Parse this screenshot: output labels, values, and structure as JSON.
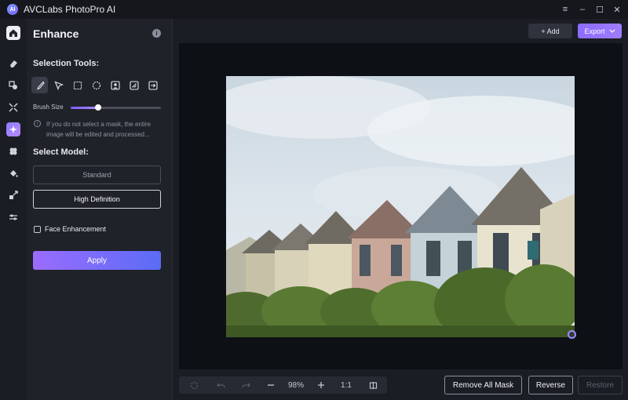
{
  "app": {
    "title": "AVCLabs PhotoPro AI",
    "logo_text": "AI"
  },
  "window_controls": {
    "settings": "≡",
    "minimize": "–",
    "maximize": "☐",
    "close": "✕"
  },
  "panel": {
    "title": "Enhance",
    "selection_tools_label": "Selection Tools:",
    "brush_size_label": "Brush Size",
    "brush_size_value": 0.3,
    "hint": "If you do not select a mask, the entire image will be edited and processed...",
    "select_model_label": "Select Model:",
    "models": [
      {
        "label": "Standard",
        "selected": false
      },
      {
        "label": "High Definition",
        "selected": true
      }
    ],
    "face_enhancement_label": "Face Enhancement",
    "face_enhancement_checked": false,
    "apply_label": "Apply"
  },
  "tools": [
    "brush-icon",
    "lasso-icon",
    "rectangle-select-icon",
    "ellipse-select-icon",
    "person-select-icon",
    "object-select-icon",
    "invert-select-icon"
  ],
  "sidebar_icons": [
    "home-icon",
    "eraser-icon",
    "object-remove-icon",
    "upscale-icon",
    "enhance-icon",
    "colorize-icon",
    "fill-icon",
    "resize-icon",
    "adjust-icon"
  ],
  "topbar": {
    "add_label": "+ Add",
    "export_label": "Export"
  },
  "zoom": {
    "value": "98%",
    "ratio": "1:1"
  },
  "bottom": {
    "remove_all_mask": "Remove All Mask",
    "reverse": "Reverse",
    "restore": "Restore"
  },
  "colors": {
    "accent": "#8f7bff",
    "background": "#1a1d24",
    "panel": "#1f2229"
  }
}
